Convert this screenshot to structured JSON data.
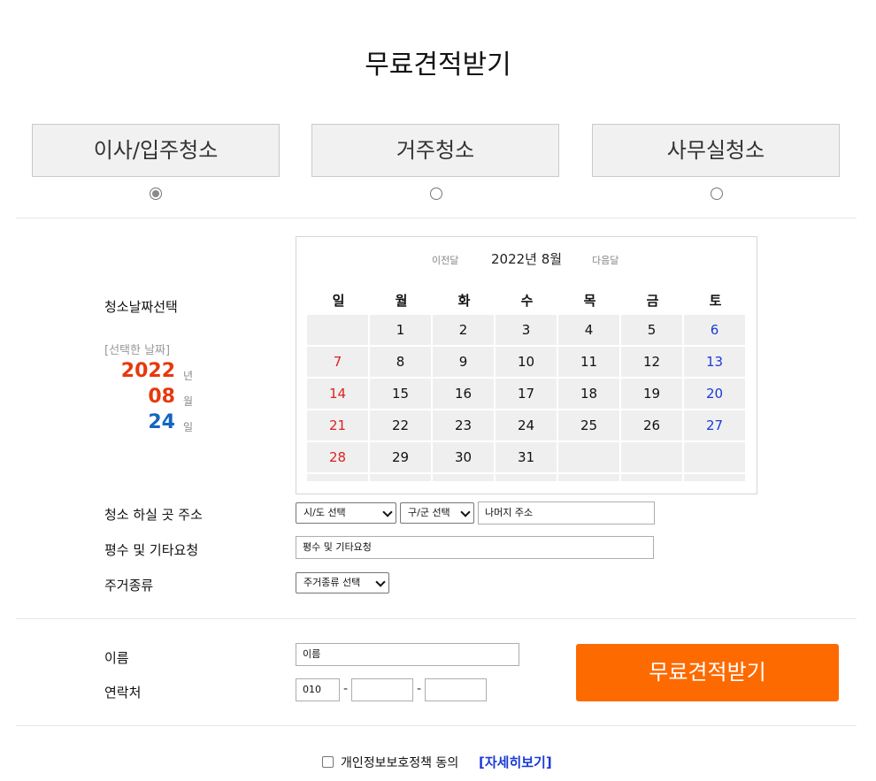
{
  "title": "무료견적받기",
  "service_types": [
    {
      "label": "이사/입주청소",
      "checked": true
    },
    {
      "label": "거주청소",
      "checked": false
    },
    {
      "label": "사무실청소",
      "checked": false
    }
  ],
  "date_section": {
    "label": "청소날짜선택",
    "selected_caption": "[선택한 날짜]",
    "year": "2022",
    "year_unit": "년",
    "month": "08",
    "month_unit": "월",
    "day": "24",
    "day_unit": "일"
  },
  "calendar": {
    "prev": "이전달",
    "title": "2022년 8월",
    "next": "다음달",
    "weekdays": [
      "일",
      "월",
      "화",
      "수",
      "목",
      "금",
      "토"
    ],
    "weeks": [
      [
        "",
        "1",
        "2",
        "3",
        "4",
        "5",
        "6"
      ],
      [
        "7",
        "8",
        "9",
        "10",
        "11",
        "12",
        "13"
      ],
      [
        "14",
        "15",
        "16",
        "17",
        "18",
        "19",
        "20"
      ],
      [
        "21",
        "22",
        "23",
        "24",
        "25",
        "26",
        "27"
      ],
      [
        "28",
        "29",
        "30",
        "31",
        "",
        "",
        ""
      ]
    ]
  },
  "address": {
    "label": "청소 하실 곳 주소",
    "sido_select": "시/도 선택",
    "gugun_select": "구/군 선택",
    "detail_placeholder": "나머지 주소"
  },
  "request": {
    "label": "평수 및 기타요청",
    "placeholder": "평수 및 기타요청"
  },
  "housing": {
    "label": "주거종류",
    "select": "주거종류 선택"
  },
  "contact": {
    "name_label": "이름",
    "name_placeholder": "이름",
    "phone_label": "연락처",
    "phone_prefix": "010",
    "dash": "-"
  },
  "submit_label": "무료견적받기",
  "agree": {
    "text": "개인정보보호정책 동의",
    "link": "[자세히보기]"
  },
  "colors": {
    "accent": "#fd6a00",
    "date_red": "#e8380d",
    "date_blue": "#1565c0",
    "sunday": "#dd2222",
    "saturday": "#1a3bd6"
  }
}
